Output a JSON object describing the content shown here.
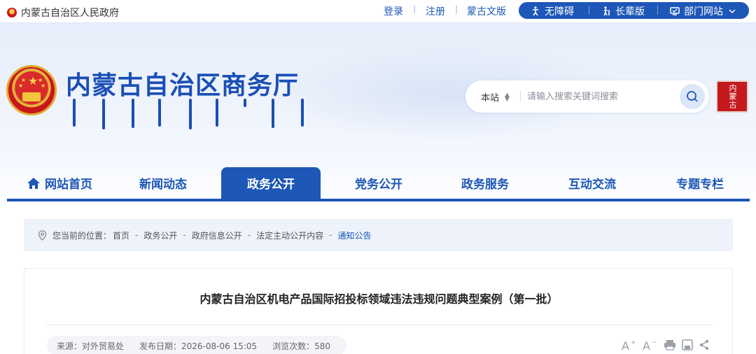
{
  "topbar": {
    "gov_name": "内蒙古自治区人民政府",
    "links": [
      "登录",
      "注册",
      "蒙古文版"
    ],
    "separators": [
      "|",
      "|"
    ],
    "tools": {
      "accessibility": "无障碍",
      "elder": "长辈版",
      "departments": "部门网站"
    }
  },
  "header": {
    "site_title": "内蒙古自治区商务厅",
    "seal_text": "内蒙古"
  },
  "search": {
    "scope": "本站",
    "placeholder": "请输入搜索关键词搜索"
  },
  "nav": {
    "items": [
      "网站首页",
      "新闻动态",
      "政务公开",
      "党务公开",
      "政务服务",
      "互动交流",
      "专题专栏"
    ],
    "active": "政务公开"
  },
  "breadcrumb": {
    "prefix": "您当前的位置：",
    "items": [
      "首页",
      "政务公开",
      "政府信息公开",
      "法定主动公开内容"
    ],
    "current": "通知公告",
    "separator": "-"
  },
  "article": {
    "title": "内蒙古自治区机电产品国际招投标领域违法违规问题典型案例（第一批）",
    "source": "来源：对外贸易处",
    "date": "发布日期：2026-08-06 15:05",
    "views": "浏览次数：580"
  },
  "colors": {
    "primary": "#1d57b7",
    "title": "#1a4fb5",
    "seal": "#c41a1f"
  }
}
